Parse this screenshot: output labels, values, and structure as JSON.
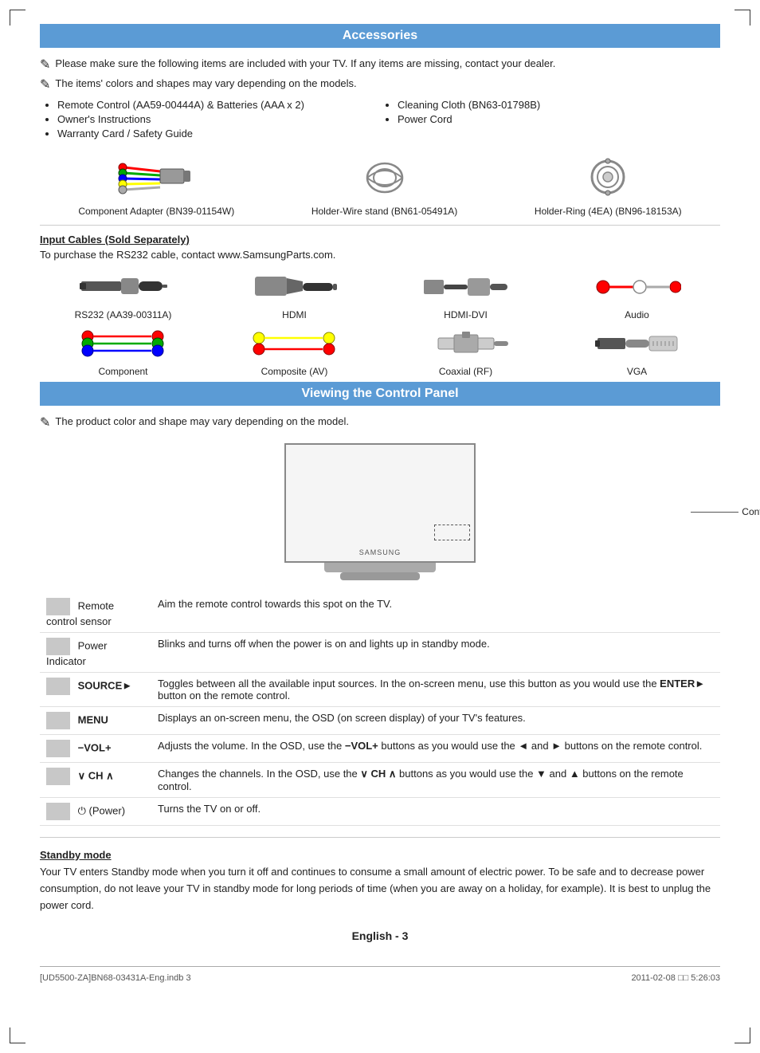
{
  "page": {
    "corners": true
  },
  "accessories": {
    "header": "Accessories",
    "note1": "Please make sure the following items are included with your TV. If any items are missing, contact your dealer.",
    "note2": "The items' colors and shapes may vary depending on the models.",
    "list_col1": [
      "Remote Control (AA59-00444A) & Batteries (AAA x 2)",
      "Owner's Instructions",
      "Warranty Card / Safety Guide"
    ],
    "list_col2": [
      "Cleaning Cloth (BN63-01798B)",
      "Power Cord"
    ],
    "accessory_items": [
      {
        "label": "Component Adapter (BN39-01154W)",
        "type": "component"
      },
      {
        "label": "Holder-Wire stand (BN61-05491A)",
        "type": "holder-wire"
      },
      {
        "label": "Holder-Ring (4EA) (BN96-18153A)",
        "type": "holder-ring"
      }
    ]
  },
  "input_cables": {
    "title": "Input Cables (Sold Separately)",
    "subtitle": "To purchase the RS232 cable, contact www.SamsungParts.com.",
    "cables_row1": [
      {
        "label": "RS232 (AA39-00311A)",
        "type": "rs232"
      },
      {
        "label": "HDMI",
        "type": "hdmi"
      },
      {
        "label": "HDMI-DVI",
        "type": "hdmi-dvi"
      },
      {
        "label": "Audio",
        "type": "audio"
      }
    ],
    "cables_row2": [
      {
        "label": "Component",
        "type": "component"
      },
      {
        "label": "Composite (AV)",
        "type": "composite"
      },
      {
        "label": "Coaxial (RF)",
        "type": "coaxial"
      },
      {
        "label": "VGA",
        "type": "vga"
      }
    ]
  },
  "control_panel": {
    "header": "Viewing the Control Panel",
    "note": "The product color and shape may vary depending on the model.",
    "panel_label": "Control Panel",
    "samsung_brand": "SAMSUNG",
    "rows": [
      {
        "name": "Remote control sensor",
        "desc": "Aim the remote control towards this spot on the TV."
      },
      {
        "name": "Power Indicator",
        "desc": "Blinks and turns off when the power is on and lights up in standby mode."
      },
      {
        "name": "SOURCE►",
        "desc": "Toggles between all the available input sources. In the on-screen menu, use this button as you would use the ENTER► button on the remote control.",
        "bold_name": true
      },
      {
        "name": "MENU",
        "desc": "Displays an on-screen menu, the OSD (on screen display) of your TV's features.",
        "bold_name": true
      },
      {
        "name": "−VOL+",
        "desc": "Adjusts the volume. In the OSD, use the −VOL+ buttons as you would use the ◄ and ► buttons on the remote control.",
        "bold_name": true
      },
      {
        "name": "∨ CH ∧",
        "desc": "Changes the channels. In the OSD, use the ∨ CH ∧ buttons as you would use the ▼ and ▲ buttons on the remote control.",
        "bold_name": true
      },
      {
        "name": "⏻ (Power)",
        "desc": "Turns the TV on or off.",
        "bold_name": false
      }
    ]
  },
  "standby": {
    "title": "Standby mode",
    "text": "Your TV enters Standby mode when you turn it off and continues to consume a small amount of electric power. To be safe and to decrease power consumption, do not leave your TV in standby mode for long periods of time (when you are away on a holiday, for example). It is best to unplug the power cord."
  },
  "footer": {
    "page_label": "English - 3",
    "file_info": "[UD5500-ZA]BN68-03431A-Eng.indb   3",
    "date_info": "2011-02-08   □□ 5:26:03"
  }
}
